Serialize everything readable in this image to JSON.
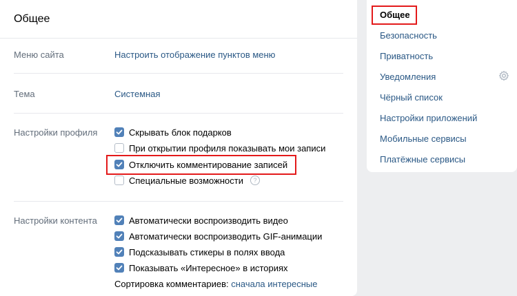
{
  "main": {
    "title": "Общее",
    "menu": {
      "label": "Меню сайта",
      "link": "Настроить отображение пунктов меню"
    },
    "theme": {
      "label": "Тема",
      "value": "Системная"
    },
    "profile": {
      "label": "Настройки профиля",
      "options": [
        {
          "label": "Скрывать блок подарков",
          "checked": true
        },
        {
          "label": "При открытии профиля показывать мои записи",
          "checked": false
        },
        {
          "label": "Отключить комментирование записей",
          "checked": true
        },
        {
          "label": "Специальные возможности",
          "checked": false,
          "help": "?"
        }
      ]
    },
    "content": {
      "label": "Настройки контента",
      "options": [
        {
          "label": "Автоматически воспроизводить видео",
          "checked": true
        },
        {
          "label": "Автоматически воспроизводить GIF-анимации",
          "checked": true
        },
        {
          "label": "Подсказывать стикеры в полях ввода",
          "checked": true
        },
        {
          "label": "Показывать «Интересное» в историях",
          "checked": true
        }
      ],
      "sort_label": "Сортировка комментариев:",
      "sort_value": "сначала интересные"
    }
  },
  "sidebar": {
    "items": [
      {
        "label": "Общее",
        "active": true
      },
      {
        "label": "Безопасность"
      },
      {
        "label": "Приватность"
      },
      {
        "label": "Уведомления",
        "icon": "gear-icon"
      },
      {
        "label": "Чёрный список"
      },
      {
        "label": "Настройки приложений"
      },
      {
        "label": "Мобильные сервисы"
      },
      {
        "label": "Платёжные сервисы"
      }
    ]
  },
  "colors": {
    "accent": "#5181b8",
    "link": "#2a5885",
    "highlight": "#e3191a"
  }
}
